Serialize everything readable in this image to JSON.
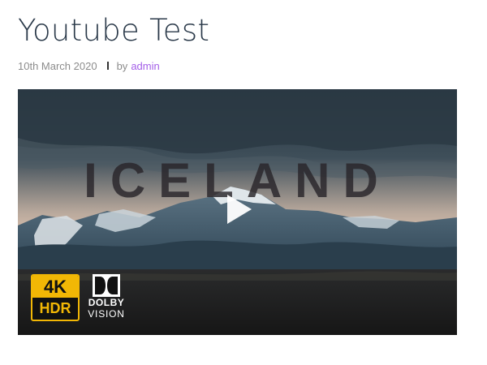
{
  "post": {
    "title": "Youtube Test",
    "date": "10th March 2020",
    "by_label": "by",
    "author": "admin"
  },
  "video": {
    "thumbnail_title": "ICELAND",
    "badge_4k": "4K",
    "badge_hdr": "HDR",
    "badge_dolby": "DOLBY",
    "badge_vision": "VISION"
  },
  "colors": {
    "title": "#2b3a4a",
    "meta": "#8c8c8c",
    "author_link": "#a35ee8",
    "badge_gold": "#f2b705"
  }
}
